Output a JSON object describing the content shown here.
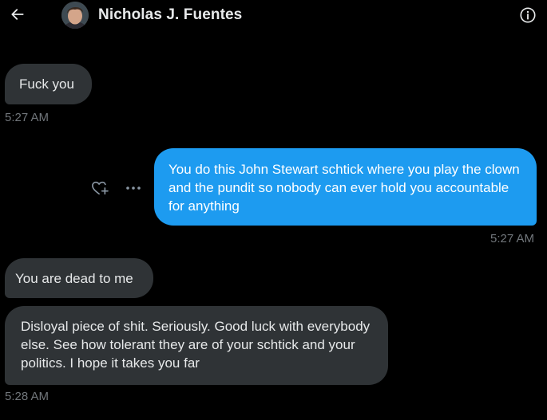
{
  "header": {
    "title": "Nicholas J. Fuentes",
    "back_icon": "arrow-left-icon",
    "info_icon": "info-icon"
  },
  "colors": {
    "background": "#000000",
    "incoming_bubble": "#2f3336",
    "outgoing_bubble": "#1d9bf0",
    "timestamp": "#71767b",
    "text": "#e7e9ea"
  },
  "messages": [
    {
      "direction": "incoming",
      "text": "Fuck you",
      "time": "5:27 AM"
    },
    {
      "direction": "outgoing",
      "text": "You do this John Stewart schtick where you play the clown and the pundit so nobody can ever hold you accountable for anything",
      "time": "5:27 AM"
    },
    {
      "direction": "incoming",
      "text": "You are dead to me",
      "time": ""
    },
    {
      "direction": "incoming",
      "text": "Disloyal piece of shit. Seriously. Good luck with everybody else. See how tolerant they are of your schtick and your politics. I hope it takes you far",
      "time": "5:28 AM"
    }
  ],
  "message_actions": {
    "react_icon": "heart-plus-icon",
    "more_icon": "more-dots-icon"
  }
}
